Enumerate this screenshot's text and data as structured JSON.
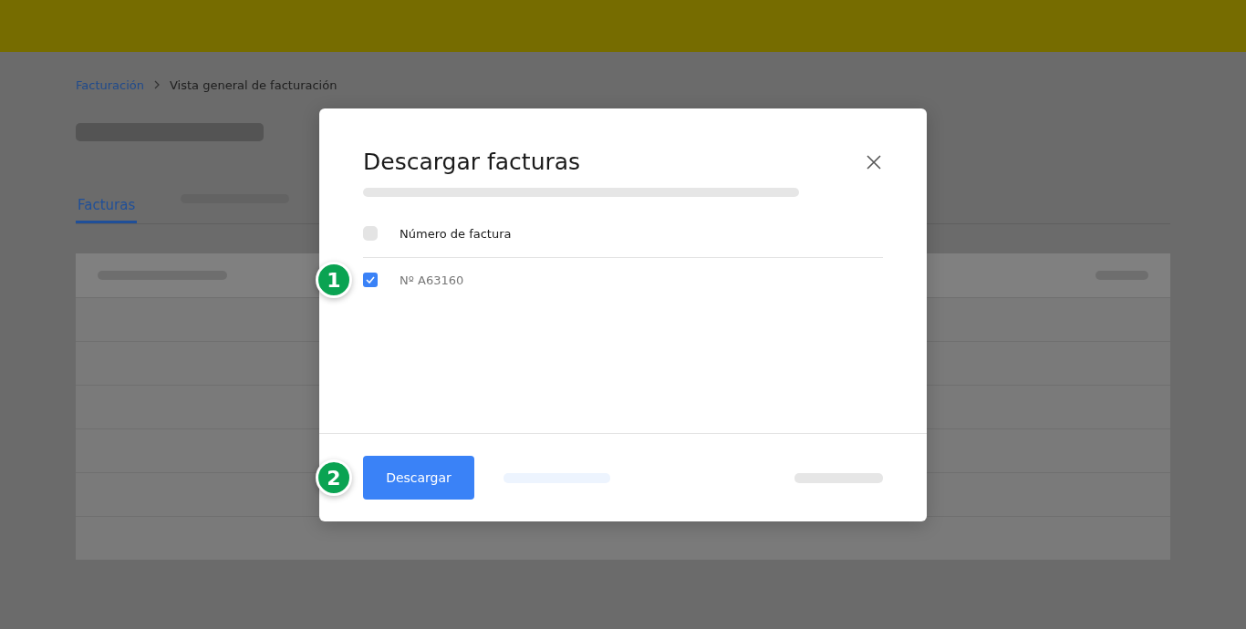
{
  "breadcrumb": [
    {
      "label": "Facturación",
      "kind": "link"
    },
    {
      "label": "Vista general de facturación",
      "kind": "current"
    }
  ],
  "tabs": [
    {
      "label": "Facturas",
      "selected": true
    }
  ],
  "dialog": {
    "title": "Descargar facturas",
    "header": {
      "label": "Número de factura",
      "checked": false
    },
    "rows": [
      {
        "label": "Nº A63160",
        "checked": true,
        "callout": "1"
      }
    ],
    "button": {
      "label": "Descargar",
      "callout": "2"
    }
  }
}
